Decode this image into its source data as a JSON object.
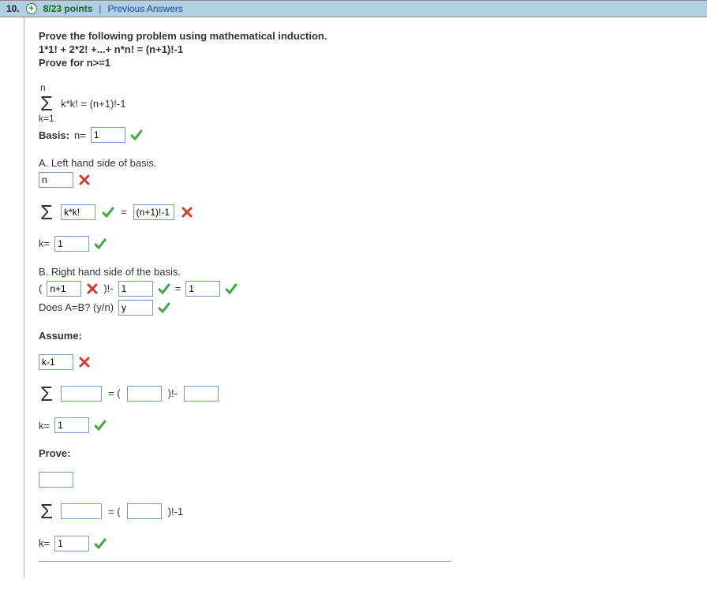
{
  "header": {
    "question_number": "10.",
    "points": "8/23 points",
    "previous": "Previous Answers"
  },
  "problem": {
    "title": "Prove the following problem using mathematical induction.",
    "equation": "1*1! + 2*2! +...+ n*n! = (n+1)!-1",
    "condition": "Prove for n>=1",
    "sigma_top": "n",
    "sigma_body": "k*k! = (n+1)!-1",
    "sigma_bottom": "k=1"
  },
  "basis": {
    "label": "Basis:",
    "n_label": "n=",
    "n_value": "1"
  },
  "partA": {
    "title": "A. Left hand side of basis.",
    "top_value": "n",
    "body_value": "k*k!",
    "equals_label": "=",
    "rhs_value": "(n+1)!-1",
    "k_label": "k=",
    "k_value": "1"
  },
  "partB": {
    "title": "B. Right hand side of the basis.",
    "open": "(",
    "v1": "n+1",
    "mid": ")!-",
    "v2": "1",
    "eq": "=",
    "v3": "1"
  },
  "doesAB": {
    "label": "Does A=B? (y/n)",
    "value": "y"
  },
  "assume": {
    "label": "Assume:",
    "top_value": "k-1",
    "body_value": "",
    "eq": "= (",
    "paren_value": "",
    "mid": ")!-",
    "tail_value": "",
    "k_label": "k=",
    "k_value": "1"
  },
  "prove": {
    "label": "Prove:",
    "top_value": "",
    "body_value": "",
    "eq": "= (",
    "paren_value": "",
    "mid": ")!-1",
    "k_label": "k=",
    "k_value": "1"
  }
}
